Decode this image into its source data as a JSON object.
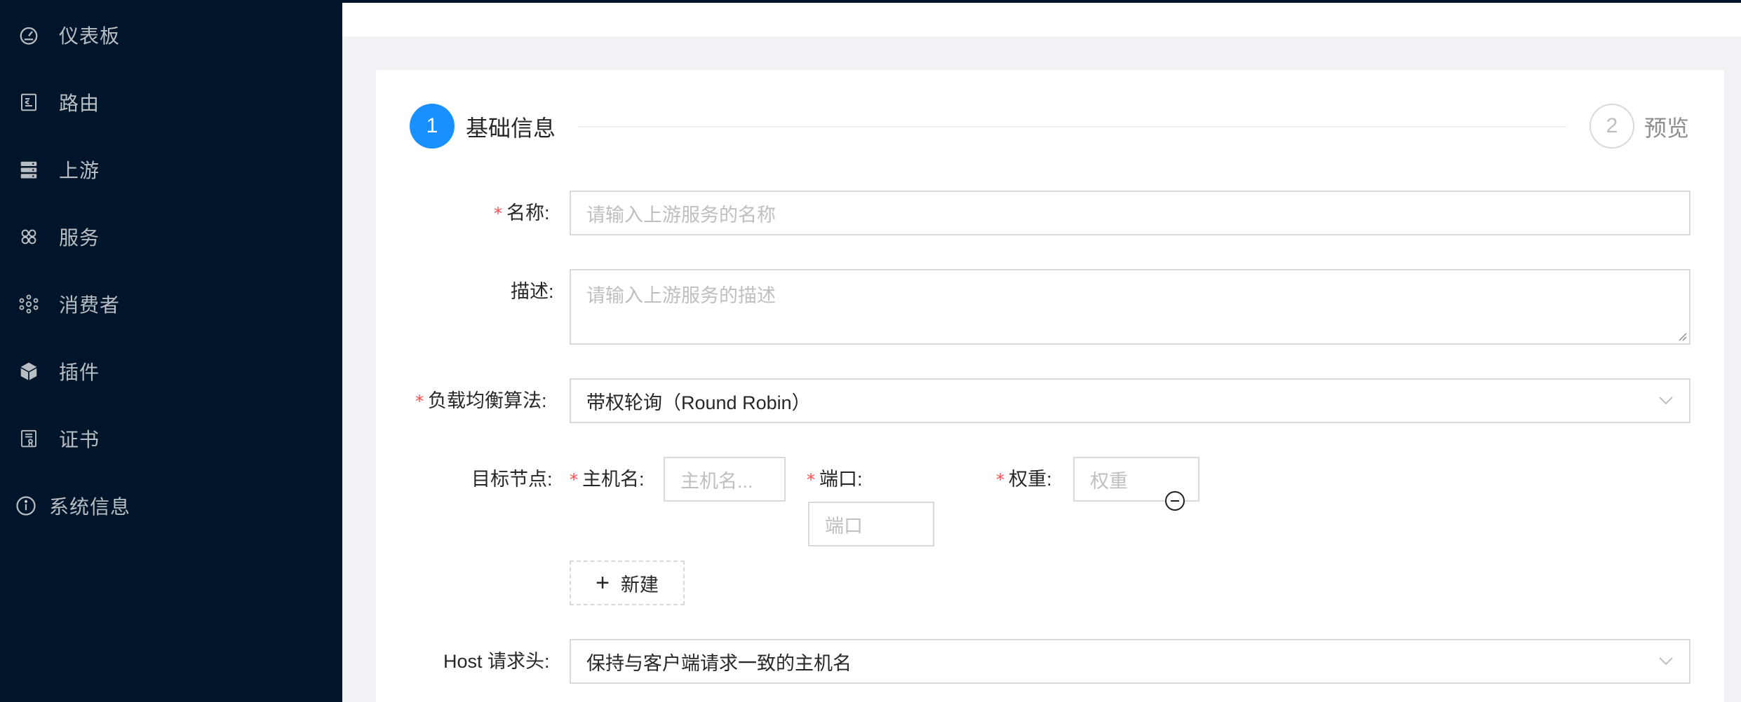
{
  "sidebar": {
    "items": [
      {
        "label": "仪表板",
        "icon": "dashboard-icon"
      },
      {
        "label": "路由",
        "icon": "route-icon"
      },
      {
        "label": "上游",
        "icon": "database-icon"
      },
      {
        "label": "服务",
        "icon": "service-icon"
      },
      {
        "label": "消费者",
        "icon": "cluster-icon"
      },
      {
        "label": "插件",
        "icon": "cube-icon"
      },
      {
        "label": "证书",
        "icon": "certificate-icon"
      },
      {
        "label": "系统信息",
        "icon": "info-icon"
      }
    ]
  },
  "steps": [
    {
      "number": "1",
      "title": "基础信息"
    },
    {
      "number": "2",
      "title": "预览"
    }
  ],
  "form": {
    "name": {
      "label": "名称:",
      "placeholder": "请输入上游服务的名称"
    },
    "description": {
      "label": "描述:",
      "placeholder": "请输入上游服务的描述"
    },
    "algorithm": {
      "label": "负载均衡算法:",
      "value": "带权轮询（Round Robin）"
    },
    "nodes": {
      "label": "目标节点:",
      "host_label": "主机名:",
      "host_placeholder": "主机名...",
      "port_label": "端口:",
      "port_placeholder": "端口",
      "weight_label": "权重:",
      "weight_placeholder": "权重",
      "add_label": "新建"
    },
    "host_header": {
      "label": "Host 请求头:",
      "value": "保持与客户端请求一致的主机名"
    }
  },
  "colors": {
    "sidebar_bg": "#001529",
    "primary": "#1890ff",
    "required": "#ff4d4f"
  }
}
